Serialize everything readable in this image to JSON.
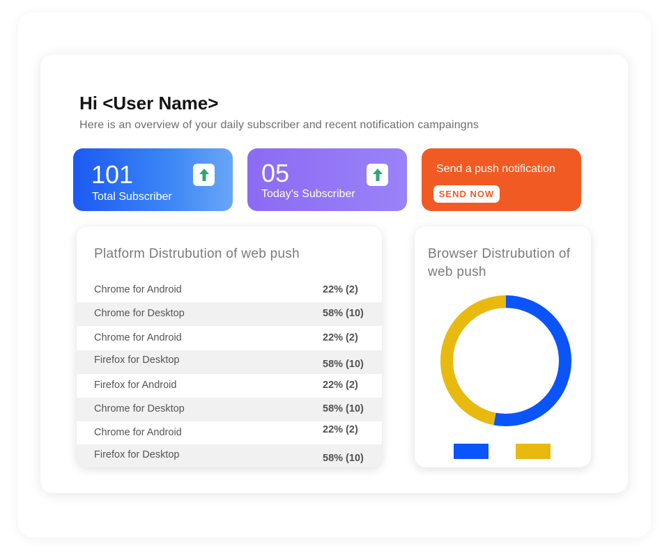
{
  "header": {
    "greeting": "Hi <User Name>",
    "subtitle": "Here is an overview of your daily subscriber and recent notification campaingns"
  },
  "stats": {
    "total": {
      "value": "101",
      "label": "Total Subscriber",
      "icon": "arrow-up-icon"
    },
    "today": {
      "value": "05",
      "label": "Today's Subscriber",
      "icon": "arrow-up-icon"
    }
  },
  "send_card": {
    "text": "Send a push notification",
    "button": "SEND NOW"
  },
  "platform": {
    "title": "Platform Distrubution of web push",
    "rows": [
      {
        "name": "Chrome for Android",
        "value": "22% (2)"
      },
      {
        "name": "Chrome for Desktop",
        "value": "58% (10)"
      },
      {
        "name": "Chrome for Android",
        "value": "22% (2)"
      },
      {
        "name": "Firefox for Desktop",
        "value": "58% (10)"
      },
      {
        "name": "Firefox for Android",
        "value": "22% (2)"
      },
      {
        "name": "Chrome for Desktop",
        "value": "58% (10)"
      },
      {
        "name": "Chrome for Android",
        "value": "22% (2)"
      },
      {
        "name": "Firefox for Desktop",
        "value": "58% (10)"
      }
    ]
  },
  "browser": {
    "title": "Browser Distrubution of web push",
    "slices": [
      {
        "color": "#0b54f9",
        "share": 0.53
      },
      {
        "color": "#e8b90f",
        "share": 0.47
      }
    ]
  },
  "colors": {
    "accent_blue": "#1b59f2",
    "accent_purple": "#8b6bf3",
    "accent_orange": "#f15a22",
    "arrow_green": "#2fa678"
  }
}
